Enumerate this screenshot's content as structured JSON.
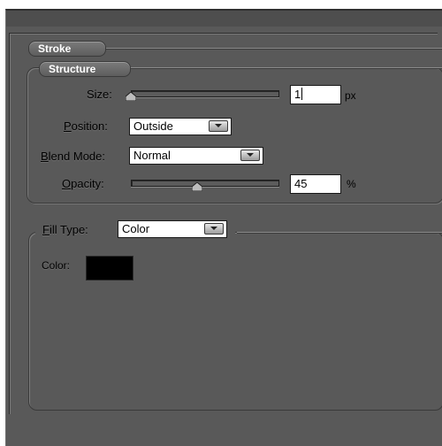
{
  "stroke": {
    "title": "Stroke",
    "structure": {
      "title": "Structure",
      "size": {
        "label": "Size:",
        "value": "1",
        "unit": "px",
        "slider_fraction": 0.0
      },
      "position": {
        "label": "Position:",
        "selected": "Outside"
      },
      "blend_mode": {
        "label": "Blend Mode:",
        "selected": "Normal"
      },
      "opacity": {
        "label": "Opacity:",
        "value": "45",
        "unit": "%",
        "slider_fraction": 0.45
      }
    },
    "fill": {
      "fill_type_label": "Fill Type:",
      "fill_type_selected": "Color",
      "color_label": "Color:",
      "color_value": "#000000"
    }
  },
  "icons": {
    "dropdown": "chevron-down-icon",
    "slider_thumb": "slider-thumb-icon"
  }
}
